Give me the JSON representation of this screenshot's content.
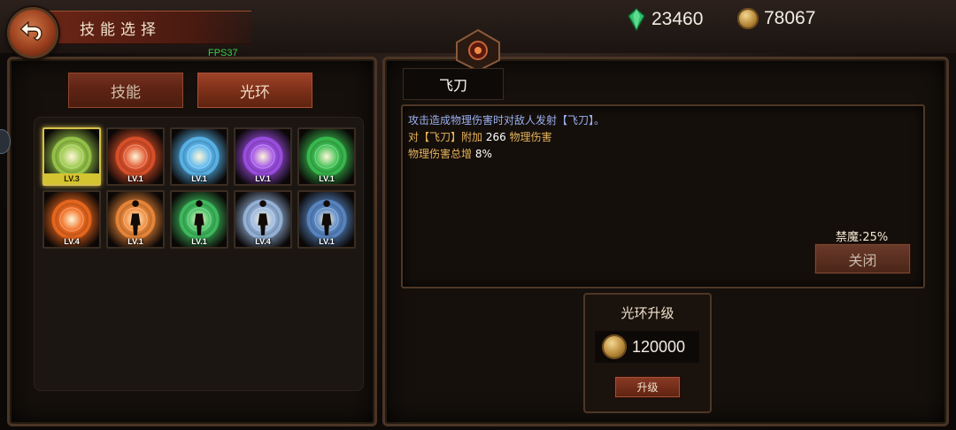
{
  "header": {
    "title": "技能选择",
    "fps": "FPS37"
  },
  "currency": {
    "gems": "23460",
    "gold": "78067"
  },
  "tabs": {
    "skill": "技能",
    "aura": "光环"
  },
  "skills": [
    {
      "level": "LV.3",
      "icon": "swirl-green-yellow-icon",
      "color": "#9ac94a",
      "selected": true
    },
    {
      "level": "LV.1",
      "icon": "fire-ring-icon",
      "color": "#e0522a"
    },
    {
      "level": "LV.1",
      "icon": "ice-snowflake-icon",
      "color": "#5ab8f0"
    },
    {
      "level": "LV.1",
      "icon": "lightning-orb-icon",
      "color": "#a050e8"
    },
    {
      "level": "LV.1",
      "icon": "poison-spider-icon",
      "color": "#3ac050"
    },
    {
      "level": "LV.4",
      "icon": "flame-vortex-icon",
      "color": "#f06a1e"
    },
    {
      "level": "LV.1",
      "icon": "fire-figure-icon",
      "color": "#f08a3a"
    },
    {
      "level": "LV.1",
      "icon": "nature-figure-icon",
      "color": "#40c060"
    },
    {
      "level": "LV.4",
      "icon": "frost-figure-icon",
      "color": "#9ab8e0"
    },
    {
      "level": "LV.1",
      "icon": "storm-figure-icon",
      "color": "#5a8ac8"
    }
  ],
  "detail": {
    "name": "飞刀",
    "line1": "攻击造成物理伤害时对敌人发射【飞刀】。",
    "line2_prefix": "对【飞刀】附加 ",
    "line2_value": "266",
    "line2_suffix": " 物理伤害",
    "line3_prefix": "物理伤害总增 ",
    "line3_value": "8%",
    "magic_resist": "禁魔:25%",
    "close_label": "关闭"
  },
  "upgrade": {
    "title": "光环升级",
    "cost": "120000",
    "button_label": "升级"
  }
}
